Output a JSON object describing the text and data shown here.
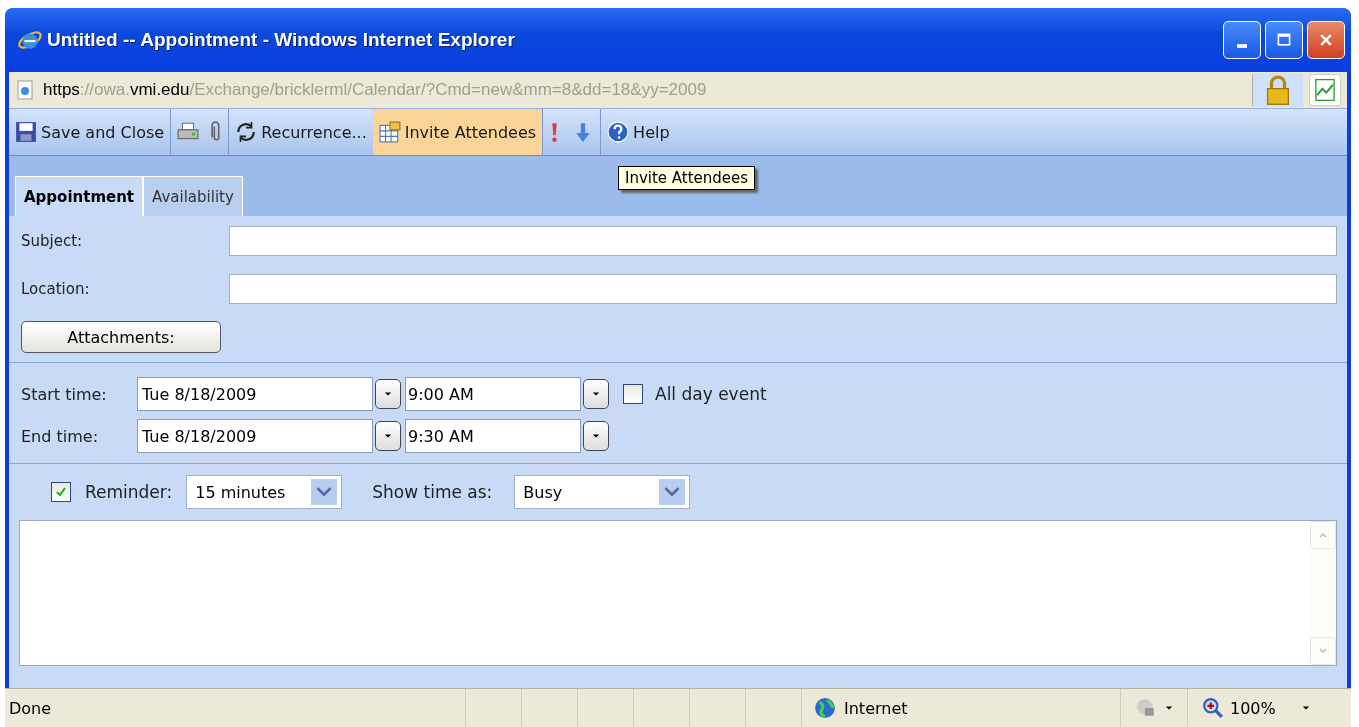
{
  "window": {
    "title": "Untitled -- Appointment - Windows Internet Explorer"
  },
  "address": {
    "segments": [
      {
        "text": "https",
        "strong": true
      },
      {
        "text": "://owa.",
        "strong": false
      },
      {
        "text": "vmi.edu",
        "strong": true
      },
      {
        "text": "/Exchange/bricklerml/Calendar/?Cmd=new&mm=8&dd=18&yy=2009",
        "strong": false
      }
    ]
  },
  "toolbar": [
    {
      "kind": "save",
      "label": "Save and Close",
      "hovered": false
    },
    {
      "kind": "print",
      "hovered": false
    },
    {
      "kind": "attach",
      "hovered": false
    },
    {
      "kind": "recurrence",
      "label": "Recurrence...",
      "hovered": false
    },
    {
      "kind": "invite",
      "label": "Invite Attendees",
      "hovered": true
    },
    {
      "kind": "important",
      "hovered": false
    },
    {
      "kind": "low",
      "hovered": false
    },
    {
      "kind": "help",
      "label": "Help",
      "hovered": false
    }
  ],
  "tooltip": "Invite Attendees",
  "tabs": [
    {
      "label": "Appointment",
      "selected": true
    },
    {
      "label": "Availability",
      "selected": false
    }
  ],
  "subject": {
    "label": "Subject:"
  },
  "location": {
    "label": "Location:"
  },
  "attachments_button": "Attachments:",
  "start": {
    "label": "Start time:",
    "date": "Tue 8/18/2009",
    "time": "9:00 AM"
  },
  "end": {
    "label": "End time:",
    "date": "Tue 8/18/2009",
    "time": "9:30 AM"
  },
  "all_day": {
    "label": "All day event",
    "checked": false
  },
  "reminder": {
    "label": "Reminder:",
    "checked": true,
    "value": "15 minutes"
  },
  "show_time_as": {
    "label": "Show time as:",
    "value": "Busy"
  },
  "status_bar": {
    "text": "Done",
    "zone": "Internet",
    "zoom": "100%"
  }
}
